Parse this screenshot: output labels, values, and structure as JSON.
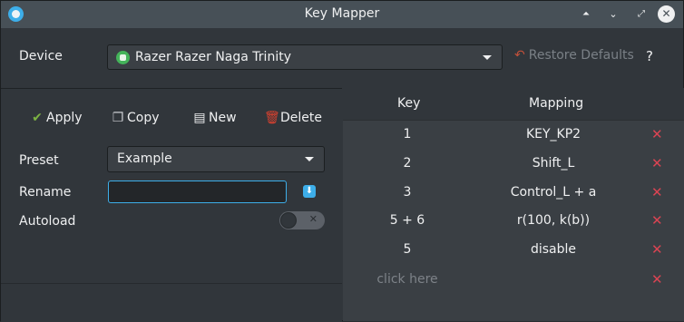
{
  "window": {
    "title": "Key Mapper",
    "controls": {
      "keep_above": "⏶",
      "minimize": "⌄",
      "maximize": "⤢",
      "close": "✕"
    }
  },
  "device": {
    "label": "Device",
    "selected": "Razer Razer Naga Trinity",
    "restore_label": "Restore Defaults",
    "help_label": "?"
  },
  "toolbar": {
    "apply": "Apply",
    "copy": "Copy",
    "new": "New",
    "delete": "Delete"
  },
  "form": {
    "preset_label": "Preset",
    "preset_value": "Example",
    "rename_label": "Rename",
    "rename_value": "",
    "autoload_label": "Autoload",
    "autoload_on": false
  },
  "table": {
    "header_key": "Key",
    "header_mapping": "Mapping",
    "rows": [
      {
        "key": "1",
        "mapping": "KEY_KP2"
      },
      {
        "key": "2",
        "mapping": "Shift_L"
      },
      {
        "key": "3",
        "mapping": "Control_L + a"
      },
      {
        "key": "5 + 6",
        "mapping": "r(100, k(b))"
      },
      {
        "key": "5",
        "mapping": "disable"
      },
      {
        "key": "click here",
        "mapping": ""
      }
    ],
    "delete_glyph": "✕"
  },
  "icons": {
    "apply": "✔",
    "copy": "❐",
    "new": "▤",
    "delete": "🗑",
    "restore": "↶",
    "save": "⬇"
  },
  "colors": {
    "accent": "#3daee9",
    "delete_red": "#da4453",
    "apply_green": "#7cb342"
  }
}
